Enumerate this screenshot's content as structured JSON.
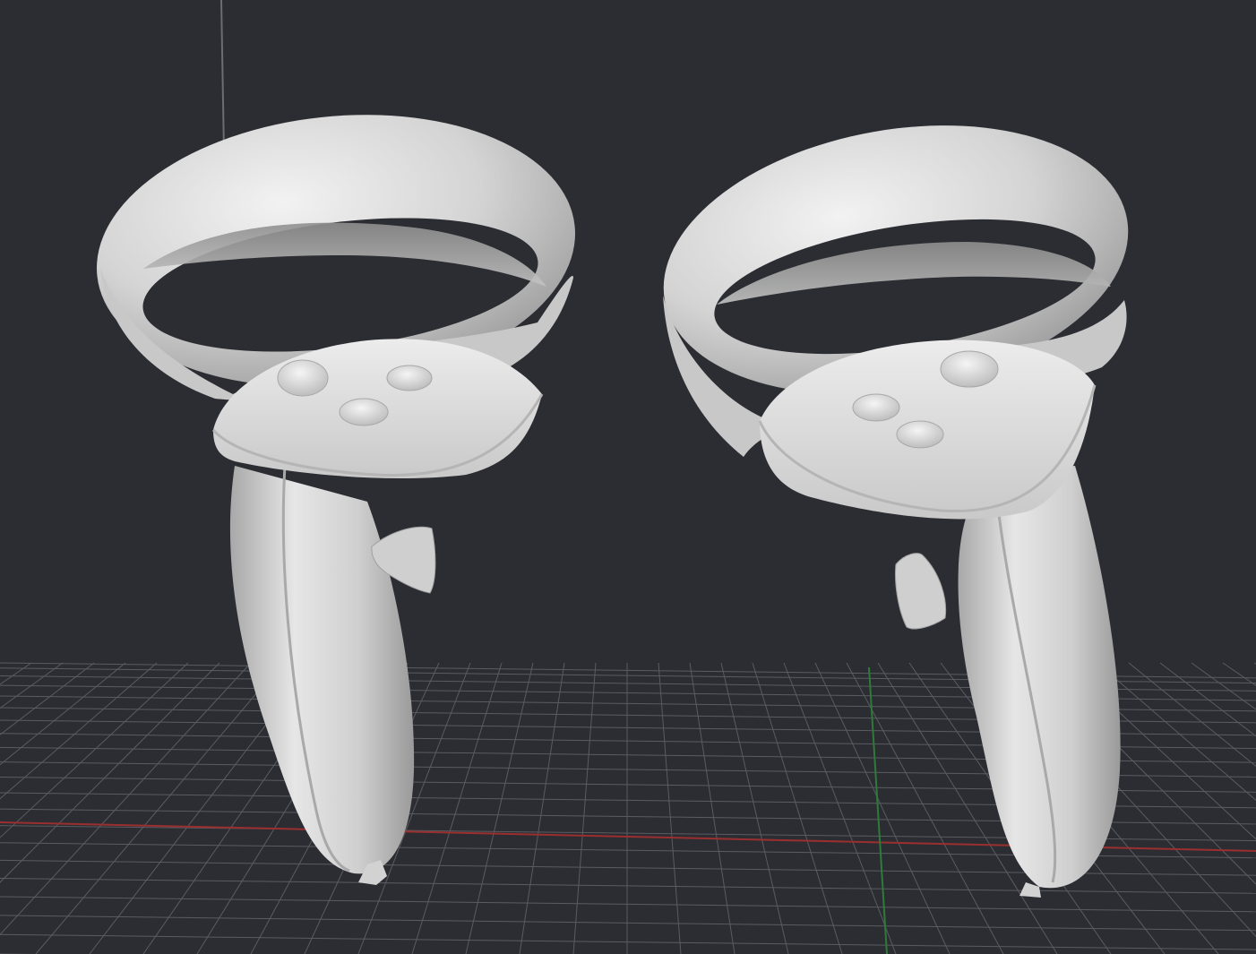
{
  "viewport": {
    "background_color": "#2c2d32",
    "grid_color": "#5a5c63",
    "x_axis_color": "#9a2f2f",
    "y_axis_color": "#2f7a3a",
    "vertical_axis_color": "#6b6d74",
    "model_color": "#d9d9d9"
  },
  "scene": {
    "objects": [
      {
        "name": "left-controller",
        "icon": "vr-controller"
      },
      {
        "name": "right-controller",
        "icon": "vr-controller"
      }
    ]
  }
}
